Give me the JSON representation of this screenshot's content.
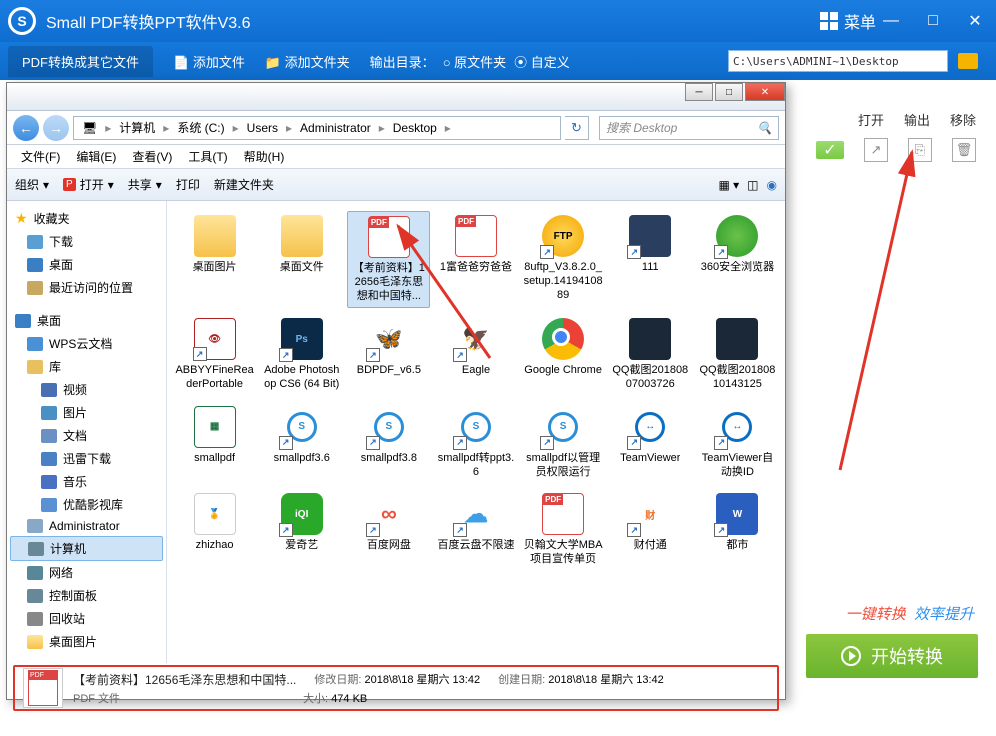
{
  "app": {
    "title": "Small PDF转换PPT软件V3.6",
    "menu_label": "菜单",
    "tab_label": "PDF转换成其它文件",
    "toolbar_add_file": "添加文件",
    "toolbar_add_folder": "添加文件夹",
    "toolbar_output_dir": "输出目录：",
    "toolbar_opt_orig": "原文件夹",
    "toolbar_opt_custom": "自定义",
    "path_value": "C:\\Users\\ADMINI~1\\Desktop"
  },
  "actions": {
    "open": "打开",
    "output": "输出",
    "remove": "移除"
  },
  "promo": {
    "a": "一键转换",
    "b": "效率提升"
  },
  "start_btn": "开始转换",
  "dialog": {
    "breadcrumb": [
      "计算机",
      "系统 (C:)",
      "Users",
      "Administrator",
      "Desktop"
    ],
    "search_placeholder": "搜索 Desktop",
    "menubar": [
      "文件(F)",
      "编辑(E)",
      "查看(V)",
      "工具(T)",
      "帮助(H)"
    ],
    "toolbar": {
      "organize": "组织",
      "open": "打开",
      "share": "共享",
      "print": "打印",
      "new_folder": "新建文件夹"
    },
    "sidebar": {
      "fav": "收藏夹",
      "downloads": "下载",
      "desktop": "桌面",
      "recent": "最近访问的位置",
      "desktop2": "桌面",
      "wps": "WPS云文档",
      "lib": "库",
      "video": "视频",
      "pictures": "图片",
      "docs": "文档",
      "xunlei": "迅雷下载",
      "music": "音乐",
      "youku": "优酷影视库",
      "admin": "Administrator",
      "computer": "计算机",
      "network": "网络",
      "control": "控制面板",
      "recycle": "回收站",
      "deskpic": "桌面图片"
    },
    "files": [
      {
        "label": "桌面图片",
        "type": "folder"
      },
      {
        "label": "桌面文件",
        "type": "folder"
      },
      {
        "label": "【考前资料】12656毛泽东思想和中国特...",
        "type": "pdf",
        "sel": true
      },
      {
        "label": "1富爸爸穷爸爸",
        "type": "pdf"
      },
      {
        "label": "8uftp_V3.8.2.0_setup.1419410889",
        "type": "ftp",
        "sc": true
      },
      {
        "label": "111",
        "type": "img",
        "sc": true
      },
      {
        "label": "360安全浏览器",
        "type": "360",
        "sc": true
      },
      {
        "label": "ABBYYFineReaderPortable",
        "type": "abbyy",
        "sc": true
      },
      {
        "label": "Adobe Photoshop CS6 (64 Bit)",
        "type": "ps",
        "sc": true
      },
      {
        "label": "BDPDF_v6.5",
        "type": "bd",
        "sc": true
      },
      {
        "label": "Eagle",
        "type": "eagle",
        "sc": true
      },
      {
        "label": "Google Chrome",
        "type": "chrome",
        "sc": true
      },
      {
        "label": "QQ截图20180807003726",
        "type": "qq"
      },
      {
        "label": "QQ截图20180810143125",
        "type": "qq"
      },
      {
        "label": "smallpdf",
        "type": "xls"
      },
      {
        "label": "smallpdf3.6",
        "type": "spdf",
        "sc": true
      },
      {
        "label": "smallpdf3.8",
        "type": "spdf",
        "sc": true
      },
      {
        "label": "smallpdf转ppt3.6",
        "type": "spdf",
        "sc": true
      },
      {
        "label": "smallpdf以管理员权限运行",
        "type": "spdf",
        "sc": true
      },
      {
        "label": "TeamViewer",
        "type": "tv",
        "sc": true
      },
      {
        "label": "TeamViewer自动换ID",
        "type": "tv",
        "sc": true
      },
      {
        "label": "zhizhao",
        "type": "cert"
      },
      {
        "label": "爱奇艺",
        "type": "iqiyi",
        "sc": true
      },
      {
        "label": "百度网盘",
        "type": "baidu",
        "sc": true
      },
      {
        "label": "百度云盘不限速",
        "type": "cloud",
        "sc": true
      },
      {
        "label": "贝翰文大学MBA项目宣传单页",
        "type": "pdf"
      },
      {
        "label": "财付通",
        "type": "cf",
        "sc": true
      },
      {
        "label": "都市",
        "type": "city",
        "sc": true
      }
    ],
    "details": {
      "title": "【考前资料】12656毛泽东思想和中国特...",
      "subtitle": "PDF 文件",
      "mod_label": "修改日期:",
      "mod_value": "2018\\8\\18 星期六 13:42",
      "create_label": "创建日期:",
      "create_value": "2018\\8\\18 星期六 13:42",
      "size_label": "大小:",
      "size_value": "474 KB"
    }
  }
}
